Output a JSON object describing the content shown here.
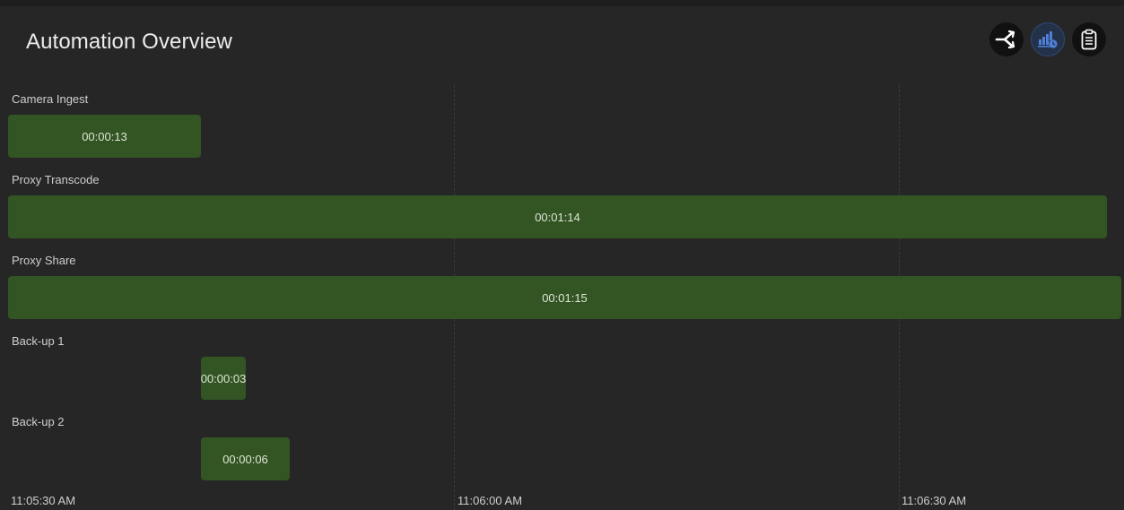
{
  "header": {
    "title": "Automation Overview",
    "buttons": [
      {
        "name": "workflow-icon",
        "active": false
      },
      {
        "name": "stats-clock-icon",
        "active": true
      },
      {
        "name": "clipboard-list-icon",
        "active": false
      }
    ]
  },
  "timeline": {
    "ticks": [
      "11:05:30 AM",
      "11:06:00 AM",
      "11:06:30 AM"
    ],
    "rows": [
      {
        "label": "Camera Ingest",
        "duration": "00:00:13"
      },
      {
        "label": "Proxy Transcode",
        "duration": "00:01:14"
      },
      {
        "label": "Proxy Share",
        "duration": "00:01:15"
      },
      {
        "label": "Back-up 1",
        "duration": "00:00:03"
      },
      {
        "label": "Back-up 2",
        "duration": "00:00:06"
      }
    ]
  },
  "colors": {
    "bar": "#335423",
    "active_button": "#2f4a78"
  }
}
